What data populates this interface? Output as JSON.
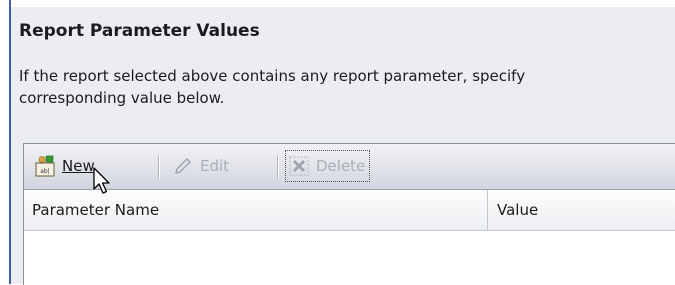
{
  "section": {
    "title": "Report Parameter Values",
    "description_lines": [
      "If the report selected above contains any report parameter, specify",
      "corresponding value below."
    ]
  },
  "toolbar": {
    "new_label": "New",
    "edit_label": "Edit",
    "delete_label": "Delete"
  },
  "table": {
    "columns": [
      "Parameter Name",
      "Value"
    ],
    "rows": []
  },
  "colors": {
    "accent_rule": "#3b5fa8",
    "panel_bg": "#ebedf3",
    "disabled_text": "#a9adb6"
  },
  "icons": {
    "new": "new-parameter-icon",
    "edit": "pencil-icon",
    "delete": "delete-x-icon",
    "cursor": "mouse-pointer-icon"
  }
}
